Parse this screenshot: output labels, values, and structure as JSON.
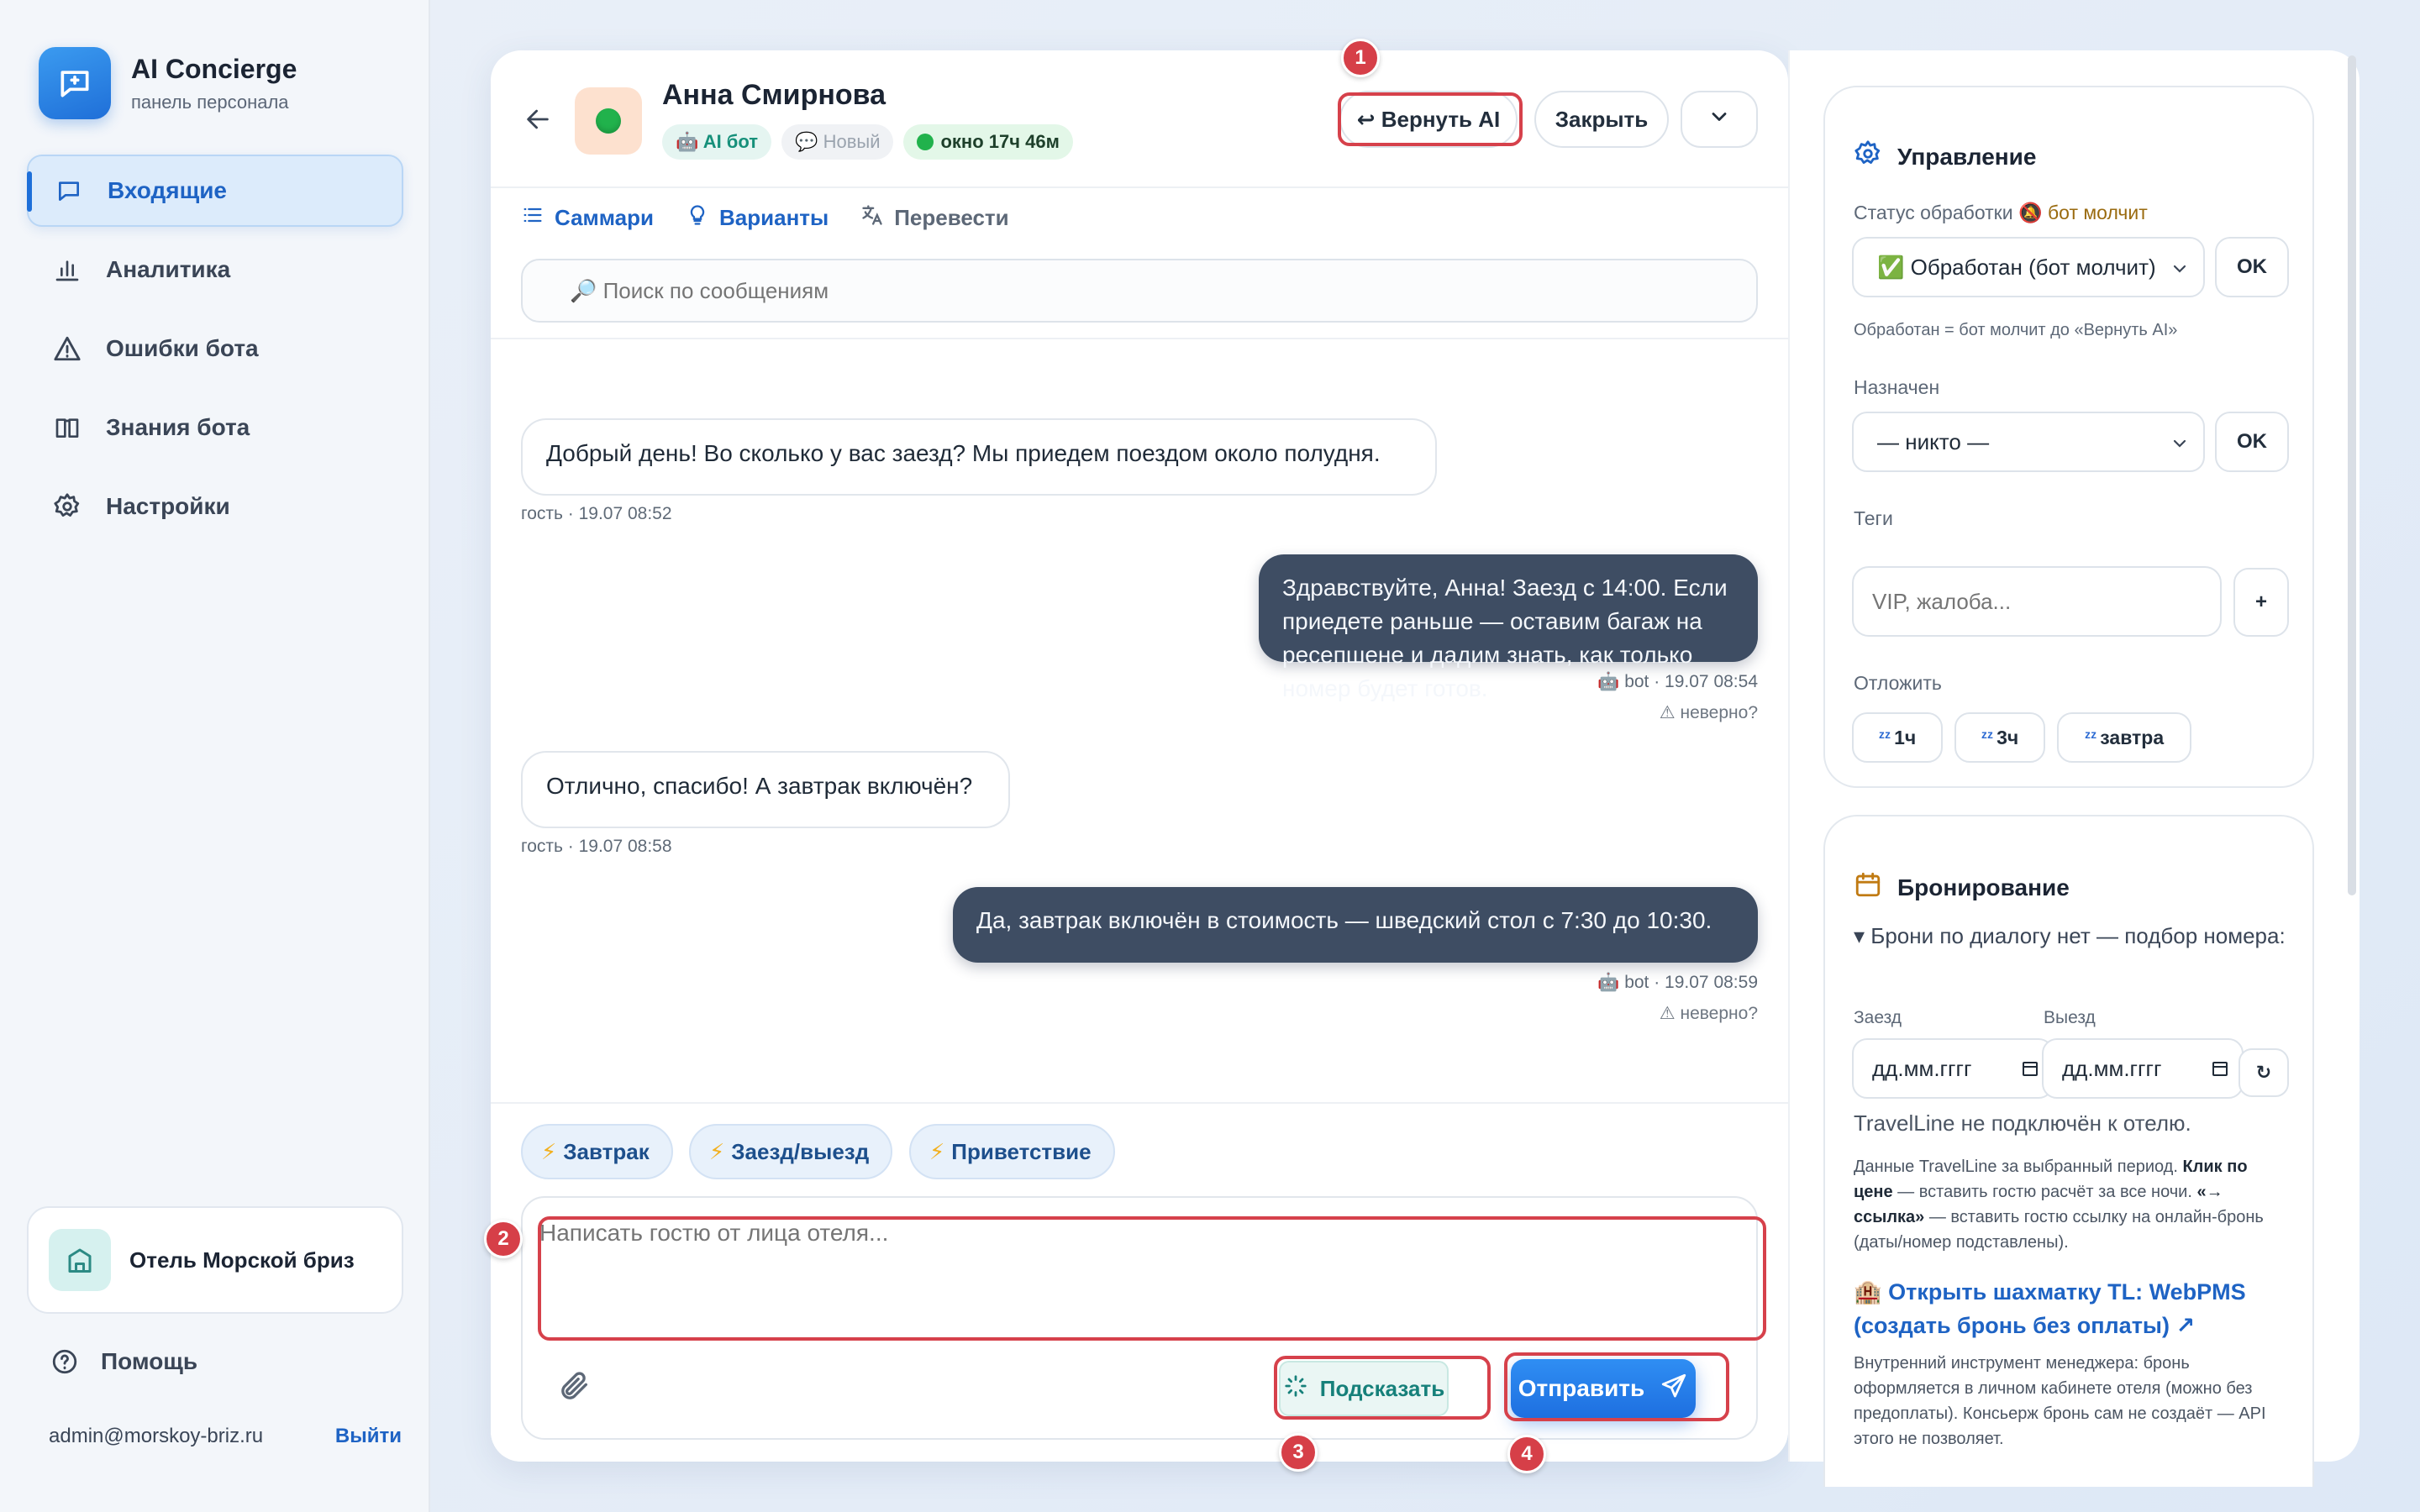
{
  "brand": {
    "title": "AI Concierge",
    "subtitle": "панель персонала"
  },
  "nav": [
    {
      "label": "Входящие",
      "icon": "chat-icon",
      "active": true
    },
    {
      "label": "Аналитика",
      "icon": "bar-chart-icon"
    },
    {
      "label": "Ошибки бота",
      "icon": "warning-icon"
    },
    {
      "label": "Знания бота",
      "icon": "book-icon"
    },
    {
      "label": "Настройки",
      "icon": "gear-icon"
    }
  ],
  "hotel": {
    "name": "Отель Морской бриз",
    "icon": "building-icon"
  },
  "help": "Помощь",
  "account": {
    "email": "admin@morskoy-briz.ru",
    "logout": "Выйти"
  },
  "chat": {
    "guest_name": "Анна Смирнова",
    "badges": {
      "ai": "🤖 AI бот",
      "new": "💬 Новый",
      "window": "окно 17ч 46м"
    },
    "buttons": {
      "return_ai": "↩ Вернуть AI",
      "close": "Закрыть"
    },
    "tools": {
      "summary": "Саммари",
      "variants": "Варианты",
      "translate": "Перевести"
    },
    "search_placeholder": "🔎 Поиск по сообщениям",
    "messages": [
      {
        "from": "guest",
        "text": "Добрый день! Во сколько у вас заезд? Мы приедем поездом около полудня.",
        "meta": "гость · 19.07 08:52"
      },
      {
        "from": "bot",
        "text": "Здравствуйте, Анна! Заезд с 14:00. Если приедете раньше — оставим багаж на ресепшене и дадим знать, как только номер будет готов.",
        "meta": "🤖 bot · 19.07 08:54",
        "flag": "⚠ неверно?"
      },
      {
        "from": "guest",
        "text": "Отлично, спасибо! А завтрак включён?",
        "meta": "гость · 19.07 08:58"
      },
      {
        "from": "bot",
        "text": "Да, завтрак включён в стоимость — шведский стол с 7:30 до 10:30.",
        "meta": "🤖 bot · 19.07 08:59",
        "flag": "⚠ неверно?"
      }
    ],
    "quick_replies": [
      "Завтрак",
      "Заезд/выезд",
      "Приветствие"
    ],
    "compose_placeholder": "Написать гостю от лица отеля...",
    "suggest": "Подсказать",
    "send": "Отправить",
    "markers": [
      "1",
      "2",
      "3",
      "4"
    ]
  },
  "manage": {
    "title": "Управление",
    "status_label": "Статус обработки",
    "status_value": "🔕 бот молчит",
    "status_select": "✅ Обработан (бот молчит)",
    "ok": "OK",
    "status_hint": "Обработан = бот молчит до «Вернуть AI»",
    "assigned_label": "Назначен",
    "assigned_value": "— никто —",
    "tags_label": "Теги",
    "tags_placeholder": "VIP, жалоба...",
    "tags_add": "+",
    "snooze_label": "Отложить",
    "snooze": [
      "1ч",
      "3ч",
      "завтра"
    ]
  },
  "booking": {
    "title": "Бронирование",
    "none": "▾ Брони по диалогу нет — подбор номера:",
    "checkin_label": "Заезд",
    "checkout_label": "Выезд",
    "date_placeholder": "дд.мм.гггг",
    "refresh": "↻",
    "tl_status": "TravelLine не подключён к отелю.",
    "tl_info_a": "Данные TravelLine за выбранный период. ",
    "tl_info_b": "Клик по цене",
    "tl_info_c": " — вставить гостю расчёт за все ночи. ",
    "tl_info_d": "«→ ссылка»",
    "tl_info_e": " — вставить гостю ссылку на онлайн-бронь (даты/номер подставлены).",
    "open_link": "🏨 Открыть шахматку TL: WebPMS (создать бронь без оплаты) ↗",
    "internal_note": "Внутренний инструмент менеджера: бронь оформляется в личном кабинете отеля (можно без предоплаты). Консьерж бронь сам не создаёт — API этого не позволяет."
  }
}
